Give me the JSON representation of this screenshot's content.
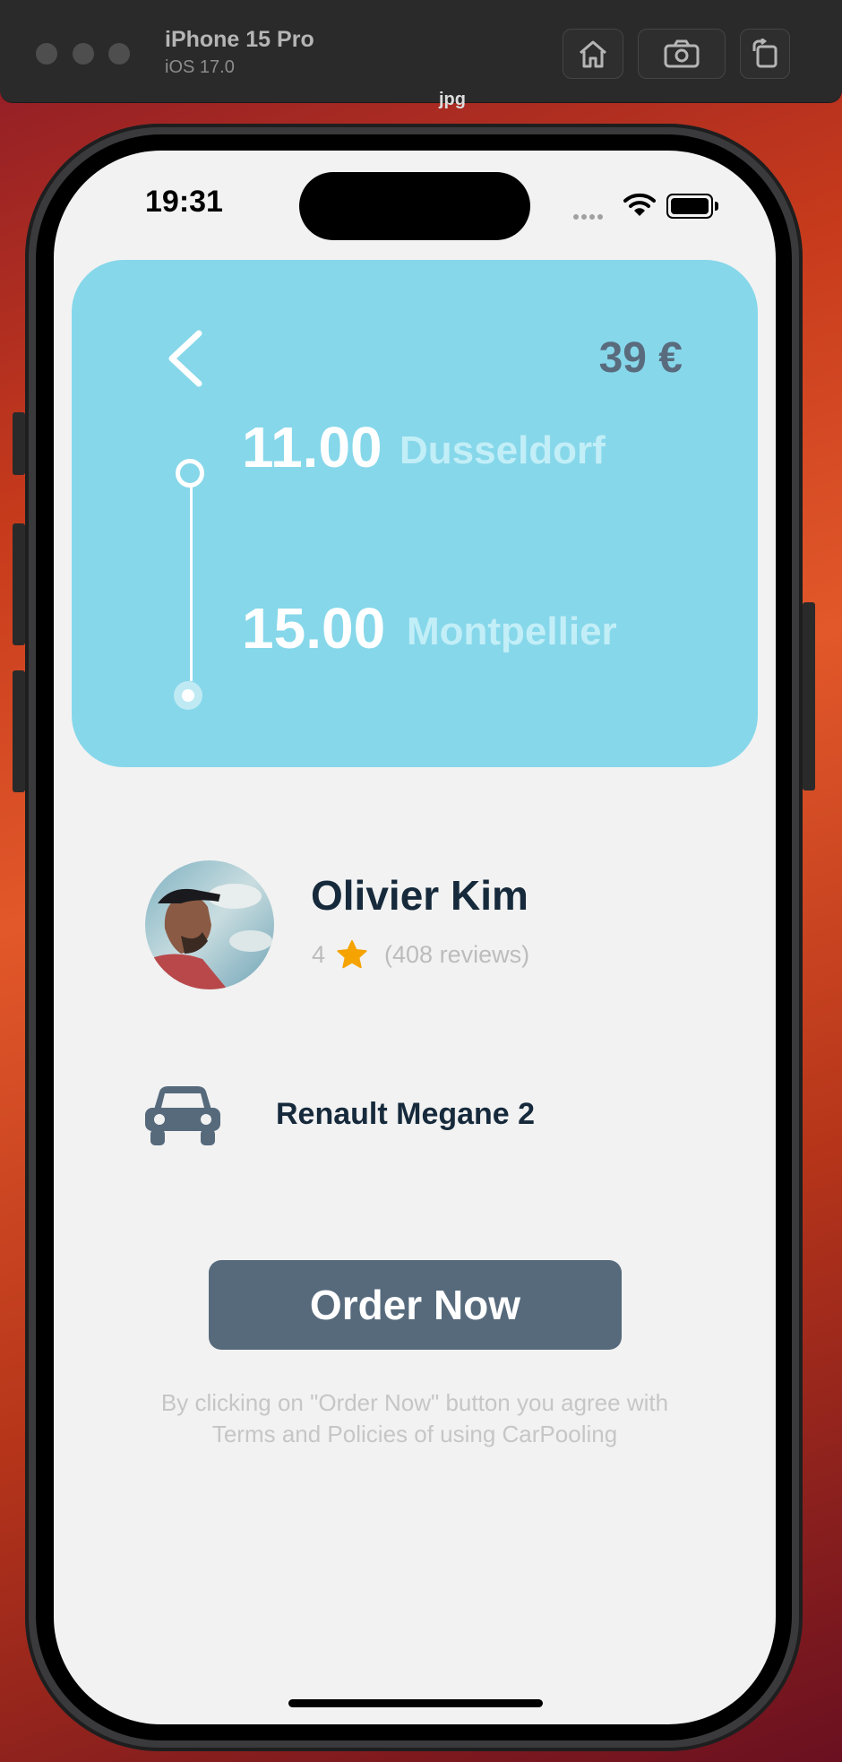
{
  "simulator": {
    "device": "iPhone 15 Pro",
    "os": "iOS 17.0",
    "file_label": "jpg",
    "buttons": [
      "home-icon",
      "screenshot-icon",
      "rotate-icon"
    ]
  },
  "status_bar": {
    "time": "19:31"
  },
  "trip": {
    "price": "39 €",
    "departure_time": "11.00",
    "departure_city": "Dusseldorf",
    "arrival_time": "15.00",
    "arrival_city": "Montpellier"
  },
  "driver": {
    "name": "Olivier Kim",
    "rating": "4",
    "reviews": "(408 reviews)"
  },
  "car": {
    "model": "Renault Megane 2"
  },
  "action": {
    "order_label": "Order Now",
    "terms_line1": "By clicking on \"Order Now\" button you agree with",
    "terms_line2": "Terms and Policies of using CarPooling"
  },
  "colors": {
    "card_bg": "#86d7ea",
    "button_bg": "#566a7c",
    "text_dark": "#162a3c",
    "star": "#f5a300"
  }
}
